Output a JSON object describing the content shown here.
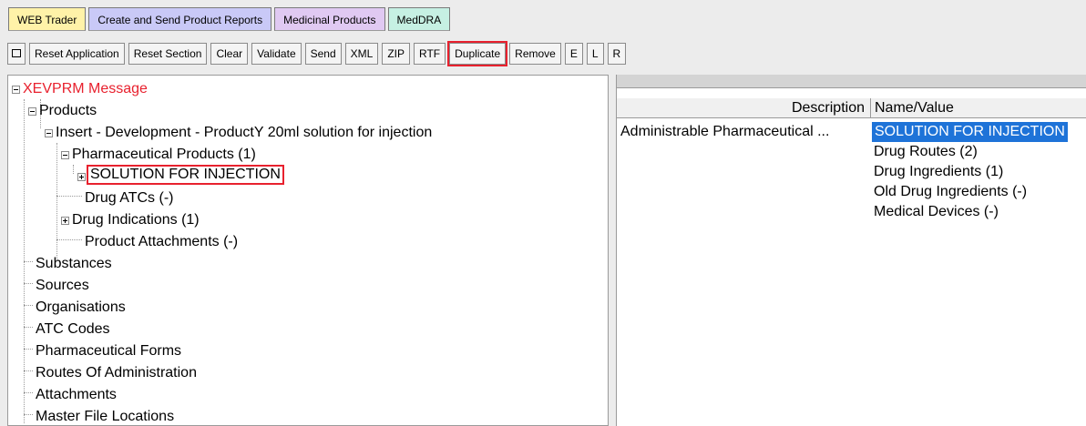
{
  "tabs": [
    {
      "label": "WEB Trader"
    },
    {
      "label": "Create and Send Product Reports"
    },
    {
      "label": "Medicinal Products"
    },
    {
      "label": "MedDRA"
    }
  ],
  "toolbar": {
    "reset_application": "Reset Application",
    "reset_section": "Reset Section",
    "clear": "Clear",
    "validate": "Validate",
    "send": "Send",
    "xml": "XML",
    "zip": "ZIP",
    "rtf": "RTF",
    "duplicate": "Duplicate",
    "remove": "Remove",
    "e": "E",
    "l": "L",
    "r": "R",
    "highlighted_button": "Duplicate",
    "highlight_color": "#e8212e"
  },
  "tree": {
    "root": "XEVPRM Message",
    "products": "Products",
    "insert": "Insert - Development - ProductY 20ml solution for injection",
    "pharm_products": "Pharmaceutical Products (1)",
    "solution": "SOLUTION FOR INJECTION",
    "drug_atcs": "Drug ATCs (-)",
    "drug_indications": "Drug Indications (1)",
    "product_attachments": "Product Attachments (-)",
    "substances": "Substances",
    "sources": "Sources",
    "organisations": "Organisations",
    "atc_codes": "ATC Codes",
    "pharm_forms": "Pharmaceutical Forms",
    "routes": "Routes Of Administration",
    "attachments": "Attachments",
    "master_file": "Master File Locations"
  },
  "details": {
    "col_description": "Description",
    "col_name_value": "Name/Value",
    "row_description": "Administrable Pharmaceutical ...",
    "values": [
      "SOLUTION FOR INJECTION",
      "Drug Routes (2)",
      "Drug Ingredients (1)",
      "Old Drug Ingredients (-)",
      "Medical Devices (-)"
    ],
    "selection_color": "#1e73d8"
  }
}
